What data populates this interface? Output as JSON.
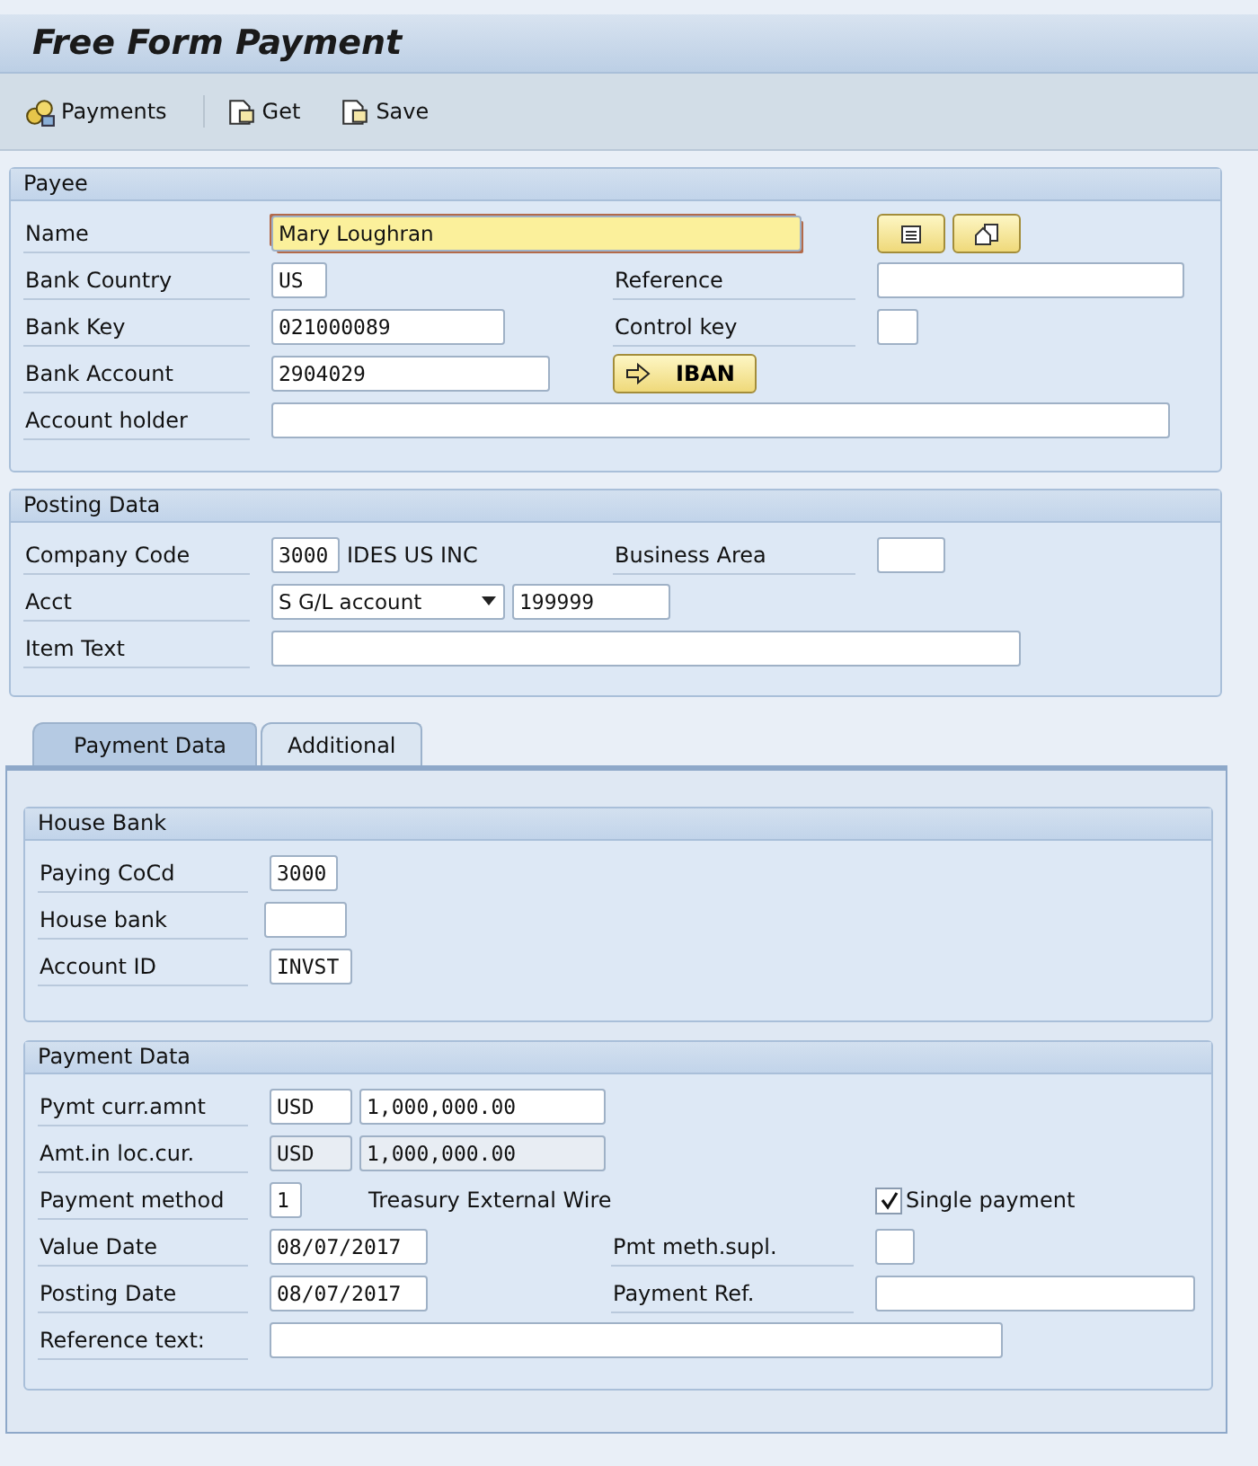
{
  "window": {
    "title": "Free Form Payment"
  },
  "toolbar": [
    {
      "label": "Payments",
      "kind": "payments"
    },
    {
      "label": "Get",
      "kind": "get"
    },
    {
      "label": "Save",
      "kind": "save"
    }
  ],
  "payee": {
    "title": "Payee",
    "name": {
      "label": "Name",
      "value": "Mary Loughran",
      "focused": true
    },
    "bank_country": {
      "label": "Bank Country",
      "value": "US"
    },
    "reference": {
      "label": "Reference"
    },
    "bank_key": {
      "label": "Bank Key",
      "value": "021000089"
    },
    "control_key": {
      "label": "Control key"
    },
    "bank_account": {
      "label": "Bank Account",
      "value": "2904029"
    },
    "iban_button": {
      "label": "IBAN"
    },
    "account_holder": {
      "label": "Account holder"
    }
  },
  "posting_data": {
    "title": "Posting Data",
    "company_code": {
      "label": "Company Code",
      "value": "3000",
      "description": "IDES US INC"
    },
    "business_area": {
      "label": "Business Area"
    },
    "acct": {
      "label": "Acct",
      "type": "S G/L account",
      "value": "199999"
    },
    "item_text": {
      "label": "Item Text"
    }
  },
  "tabs": [
    {
      "label": "Payment Data",
      "selected": true
    },
    {
      "label": "Additional",
      "selected": false
    }
  ],
  "house_bank": {
    "title": "House Bank",
    "paying_cocd": {
      "label": "Paying CoCd",
      "value": "3000"
    },
    "house_bank": {
      "label": "House bank"
    },
    "account_id": {
      "label": "Account ID",
      "value": "INVST"
    }
  },
  "payment_data": {
    "title": "Payment Data",
    "pymt_curr_amnt": {
      "label": "Pymt curr.amnt",
      "currency": "USD",
      "amount": "1,000,000.00",
      "disabled": false
    },
    "amt_in_loc_cur": {
      "label": "Amt.in loc.cur.",
      "currency": "USD",
      "amount": "1,000,000.00",
      "disabled": true
    },
    "payment_method": {
      "label": "Payment method",
      "value": "1",
      "description": "Treasury External Wire"
    },
    "single_payment": {
      "label": "Single payment",
      "checked": true
    },
    "value_date": {
      "label": "Value Date",
      "value": "08/07/2017"
    },
    "pmt_meth_supl": {
      "label": "Pmt meth.supl."
    },
    "posting_date": {
      "label": "Posting Date",
      "value": "08/07/2017"
    },
    "payment_ref": {
      "label": "Payment Ref."
    },
    "reference_text": {
      "label": "Reference text:"
    }
  }
}
